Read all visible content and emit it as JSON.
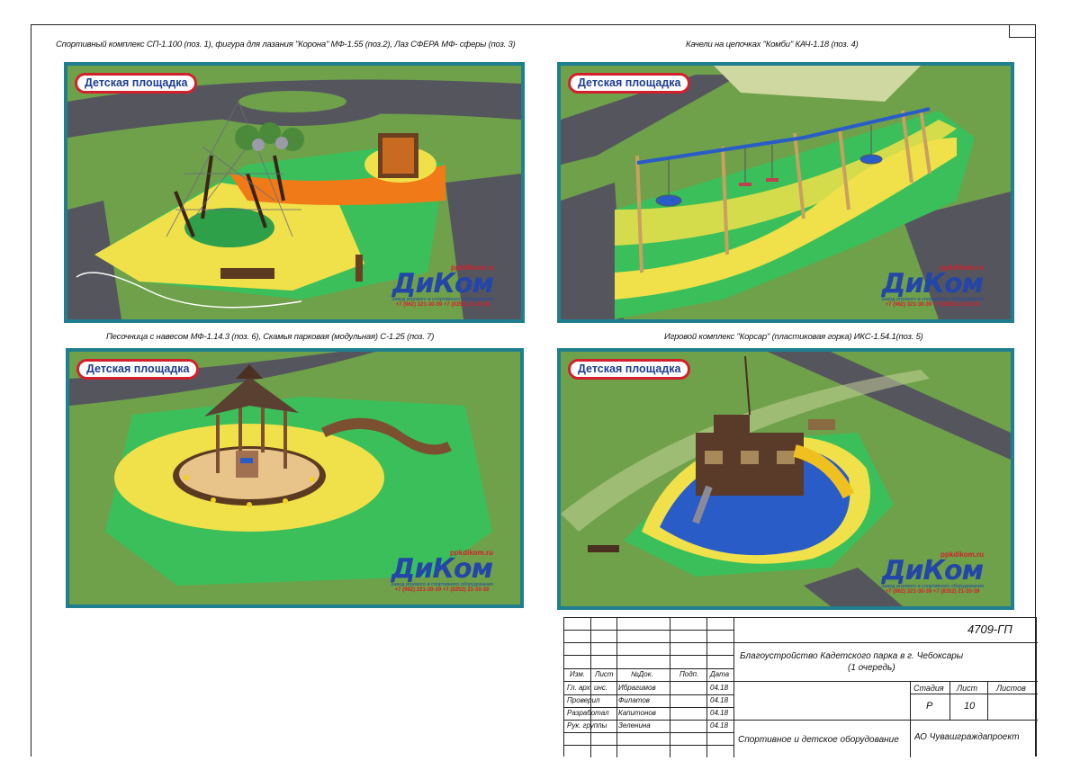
{
  "captions": {
    "panel1": "Спортивный комплекс СП-1.100 (поз. 1), фигура для лазания \"Корона\" МФ-1.55 (поз.2), Лаз СФЕРА МФ- сферы (поз. 3)",
    "panel2": "Качели на цепочках \"Комби\" КАЧ-1.18 (поз. 4)",
    "panel3": "Песочница с навесом МФ-1.14.3 (поз. 6), Скамья парковая (модульная) С-1.25 (поз. 7)",
    "panel4": "Игровой комплекс \"Корсар\" (пластиковая горка) ИКС-1.54.1(поз. 5)"
  },
  "panel_badge": "Детская площадка",
  "logo": {
    "site": "ppkdikom.ru",
    "name": "ДиКом",
    "tagline": "Завод игрового и спортивного оборудования",
    "phones": "+7 (962) 321-30-39   +7 (8352) 21-30-39"
  },
  "stamp": {
    "code": "4709-ГП",
    "project_title": "Благоустройство Кадетского парка в  г. Чебоксары",
    "project_subtitle": "(1 очередь)",
    "header": {
      "izm": "Изм.",
      "list": "Лист",
      "doc": "№Док.",
      "sign": "Подп.",
      "date": "Дата"
    },
    "stage_label": "Стадия",
    "sheet_label": "Лист",
    "sheets_label": "Листов",
    "stage": "Р",
    "sheet": "10",
    "sheets": "",
    "drawing_name": "Спортивное и детское оборудование",
    "organization": "АО Чувашграждапроект",
    "signers": [
      {
        "role": "Гл. арх. инс.",
        "name": "Ибрагимов",
        "date": "04.18"
      },
      {
        "role": "Проверил",
        "name": "Филатов",
        "date": "04.18"
      },
      {
        "role": "Разработал",
        "name": "Капитонов",
        "date": "04.18"
      },
      {
        "role": "Рук. группы",
        "name": "Зеленина",
        "date": "04.18"
      }
    ]
  },
  "colors": {
    "frame": "#1f7f8e",
    "badge_border": "#d4202c",
    "badge_text": "#1d3d8f",
    "grass": "#6fa04a",
    "rubber_green": "#3bbf5a",
    "rubber_yellow": "#f0e04a",
    "rubber_orange": "#f07a18",
    "rubber_blue": "#2a5cc8",
    "asphalt": "#55555e"
  }
}
